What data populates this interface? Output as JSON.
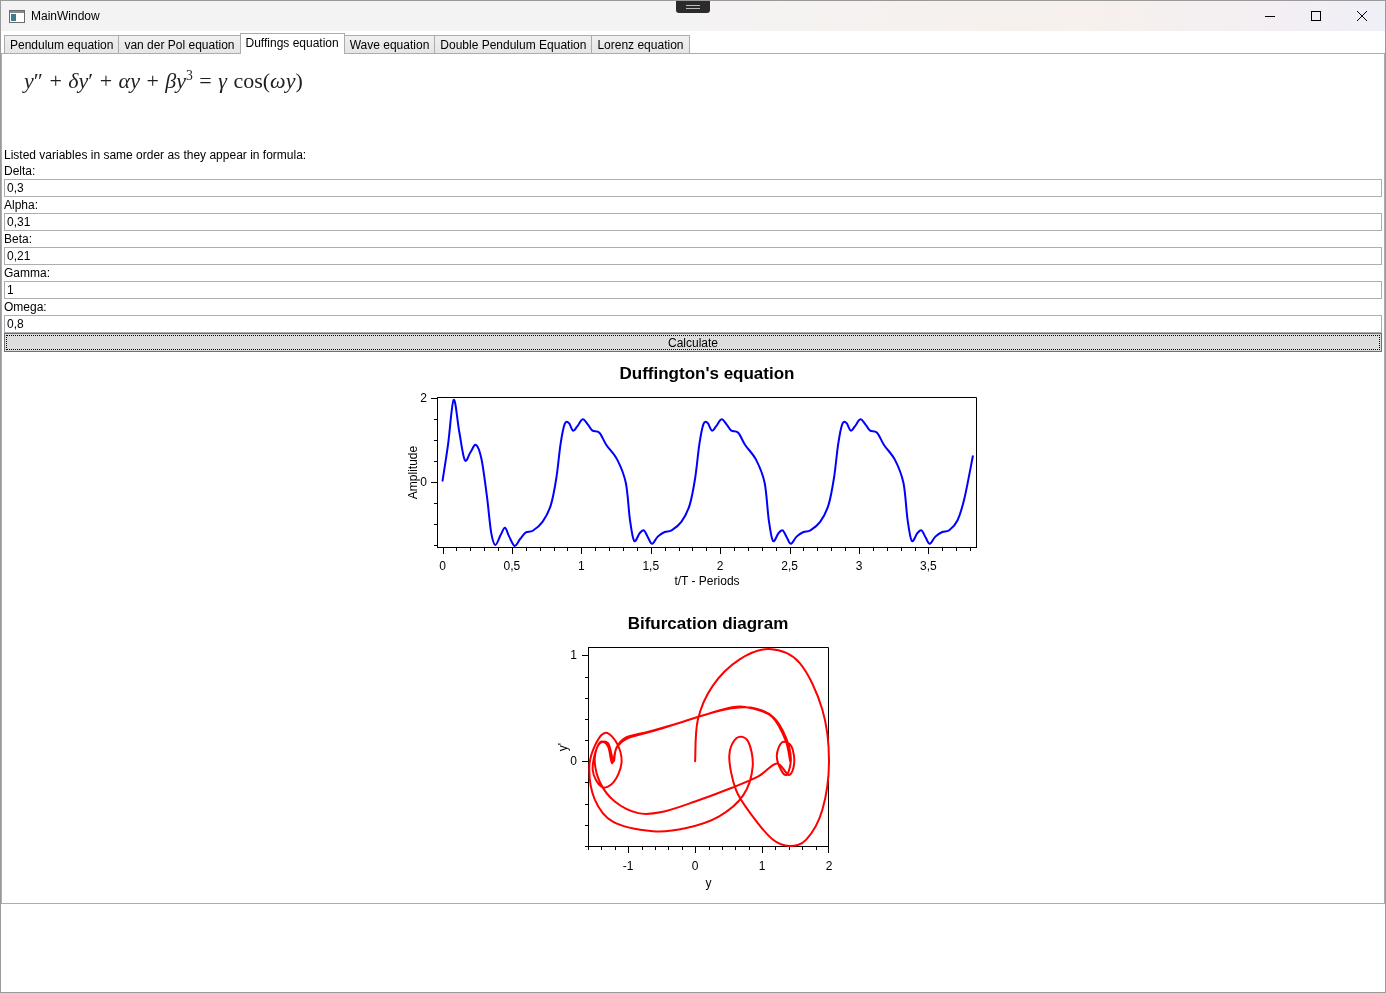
{
  "window": {
    "title": "MainWindow"
  },
  "tabs": [
    {
      "label": "Pendulum equation",
      "selected": false
    },
    {
      "label": "van der Pol equation",
      "selected": false
    },
    {
      "label": "Duffings equation",
      "selected": true
    },
    {
      "label": "Wave equation",
      "selected": false
    },
    {
      "label": "Double Pendulum Equation",
      "selected": false
    },
    {
      "label": "Lorenz equation",
      "selected": false
    }
  ],
  "formula": "*y*″ + *δy*′ + *αy* + *βy*$^{3}$ = *γ* cos(*ωy*)",
  "instructions": "Listed variables in same order as they appear in formula:",
  "fields": [
    {
      "label": "Delta:",
      "value": "0,3"
    },
    {
      "label": "Alpha:",
      "value": "0,31"
    },
    {
      "label": "Beta:",
      "value": "0,21"
    },
    {
      "label": "Gamma:",
      "value": "1"
    },
    {
      "label": "Omega:",
      "value": "0,8"
    }
  ],
  "calculate_button": {
    "label": "Calculate",
    "focused": true
  },
  "charts": [
    {
      "chart_data": {
        "type": "line",
        "title": "Duffington's equation",
        "xlabel": "t/T - Periods",
        "ylabel": "Amplitude",
        "x": [
          0,
          0.04,
          0.08,
          0.12,
          0.16,
          0.2,
          0.24,
          0.28,
          0.32,
          0.35,
          0.38,
          0.42,
          0.45,
          0.48,
          0.52,
          0.56,
          0.6,
          0.65,
          0.72,
          0.78,
          0.82,
          0.85,
          0.88,
          0.91,
          0.94,
          0.97,
          1.01,
          1.05,
          1.08,
          1.13,
          1.18,
          1.26,
          1.32,
          1.35,
          1.38,
          1.42,
          1.45,
          1.48,
          1.51,
          1.55,
          1.6,
          1.65,
          1.72,
          1.78,
          1.82,
          1.85,
          1.88,
          1.91,
          1.94,
          1.97,
          2.01,
          2.05,
          2.08,
          2.13,
          2.18,
          2.26,
          2.32,
          2.35,
          2.38,
          2.42,
          2.45,
          2.48,
          2.51,
          2.55,
          2.6,
          2.65,
          2.72,
          2.78,
          2.82,
          2.85,
          2.88,
          2.91,
          2.94,
          2.97,
          3.01,
          3.05,
          3.08,
          3.13,
          3.18,
          3.26,
          3.32,
          3.35,
          3.38,
          3.42,
          3.45,
          3.48,
          3.51,
          3.55,
          3.6,
          3.65,
          3.71,
          3.76,
          3.82
        ],
        "series": [
          {
            "color": "#0000ff",
            "values": [
              0.03,
              0.9,
              1.95,
              1.2,
              0.52,
              0.7,
              0.88,
              0.55,
              -0.35,
              -1.2,
              -1.5,
              -1.25,
              -1.09,
              -1.3,
              -1.52,
              -1.35,
              -1.2,
              -1.16,
              -0.95,
              -0.55,
              0.1,
              0.9,
              1.38,
              1.4,
              1.22,
              1.32,
              1.49,
              1.35,
              1.22,
              1.17,
              0.88,
              0.52,
              -0.02,
              -0.9,
              -1.4,
              -1.22,
              -1.15,
              -1.32,
              -1.47,
              -1.3,
              -1.19,
              -1.15,
              -0.95,
              -0.55,
              0.1,
              0.9,
              1.38,
              1.4,
              1.22,
              1.32,
              1.49,
              1.35,
              1.22,
              1.17,
              0.88,
              0.52,
              -0.02,
              -0.9,
              -1.4,
              -1.22,
              -1.15,
              -1.32,
              -1.47,
              -1.3,
              -1.19,
              -1.15,
              -0.95,
              -0.55,
              0.1,
              0.9,
              1.38,
              1.4,
              1.22,
              1.32,
              1.49,
              1.35,
              1.22,
              1.17,
              0.88,
              0.52,
              -0.02,
              -0.9,
              -1.4,
              -1.22,
              -1.15,
              -1.32,
              -1.47,
              -1.3,
              -1.19,
              -1.15,
              -0.91,
              -0.38,
              0.61
            ]
          }
        ],
        "xlim": [
          -0.04,
          3.85
        ],
        "ylim": [
          -1.57,
          2.02
        ],
        "xticks": [
          0,
          {
            "value": 0.5,
            "label": "0,5"
          },
          1,
          {
            "value": 1.5,
            "label": "1,5"
          },
          2,
          {
            "value": 2.5,
            "label": "2,5"
          },
          3,
          {
            "value": 3.5,
            "label": "3,5"
          }
        ],
        "yticks": [
          0,
          2
        ]
      }
    },
    {
      "chart_data": {
        "type": "line",
        "title": "Bifurcation diagram",
        "xlabel": "y",
        "ylabel": "y'",
        "x": [
          0,
          0.04,
          0.26,
          0.66,
          1.11,
          1.56,
          1.9,
          2.0,
          1.9,
          1.66,
          1.41,
          1.16,
          0.86,
          0.61,
          0.51,
          0.62,
          0.79,
          0.86,
          0.72,
          0.36,
          -0.13,
          -0.63,
          -1.23,
          -1.5,
          -1.58,
          -1.48,
          -1.33,
          -1.16,
          -1.1,
          -1.22,
          -1.4,
          -1.53,
          -1.45,
          -1.3,
          -1.22,
          -1.18,
          -1.05,
          -0.7,
          -0.3,
          0.1,
          0.55,
          0.9,
          1.18,
          1.36,
          1.43,
          1.38,
          1.3,
          1.22,
          1.3,
          1.44,
          1.48,
          1.4,
          1.22,
          0.95,
          0.55,
          0,
          -0.5,
          -0.85,
          -1.2,
          -1.42,
          -1.5,
          -1.42,
          -1.3,
          -1.24,
          -1.17,
          -1.0,
          -0.6,
          0,
          0.55,
          0.85,
          1.15,
          1.35,
          1.42
        ],
        "series": [
          {
            "color": "#ff0000",
            "values": [
              0,
              0.39,
              0.71,
              0.96,
              1.06,
              0.93,
              0.49,
              0,
              -0.46,
              -0.74,
              -0.8,
              -0.74,
              -0.52,
              -0.27,
              0.05,
              0.22,
              0.19,
              -0.05,
              -0.32,
              -0.52,
              -0.63,
              -0.66,
              -0.57,
              -0.36,
              -0.05,
              0.17,
              0.27,
              0.16,
              -0.02,
              -0.2,
              -0.24,
              -0.08,
              0.15,
              0.17,
              0,
              0.12,
              0.22,
              0.28,
              0.35,
              0.43,
              0.5,
              0.5,
              0.41,
              0.22,
              0.03,
              -0.12,
              -0.1,
              0.05,
              0.18,
              0.14,
              -0.02,
              -0.13,
              -0.02,
              -0.14,
              -0.25,
              -0.38,
              -0.48,
              -0.49,
              -0.38,
              -0.2,
              0.02,
              0.18,
              0.14,
              -0.02,
              0.13,
              0.22,
              0.29,
              0.41,
              0.51,
              0.5,
              0.42,
              0.2,
              0
            ]
          }
        ],
        "xlim": [
          -1.6,
          2.0
        ],
        "ylim": [
          -0.81,
          1.08
        ],
        "xticks": [
          -1,
          0,
          1,
          2
        ],
        "yticks": [
          0,
          1
        ]
      }
    }
  ]
}
